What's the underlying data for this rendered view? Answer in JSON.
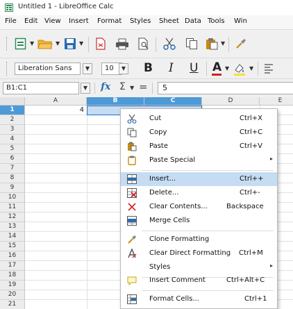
{
  "window": {
    "title": "Untitled 1 - LibreOffice Calc"
  },
  "menubar": {
    "items": [
      "File",
      "Edit",
      "View",
      "Insert",
      "Format",
      "Styles",
      "Sheet",
      "Data",
      "Tools",
      "Win"
    ]
  },
  "toolbar": {
    "font_name": "Liberation Sans",
    "font_size": "10",
    "bold_label": "B",
    "italic_label": "I",
    "underline_label": "U",
    "font_color_label": "A"
  },
  "formula_bar": {
    "name_box": "B1:C1",
    "fx_label": "fx",
    "sum_label": "Σ",
    "equals_label": "=",
    "content": "5"
  },
  "sheet": {
    "columns": [
      "A",
      "B",
      "C",
      "D",
      "E"
    ],
    "rows": [
      "1",
      "2",
      "3",
      "4",
      "5",
      "6",
      "7",
      "8",
      "9",
      "10",
      "11",
      "12",
      "13",
      "14",
      "15",
      "16",
      "17",
      "18",
      "19",
      "20",
      "21"
    ],
    "selected_columns": [
      "B",
      "C"
    ],
    "selected_row": "1",
    "cells": {
      "A1": "4"
    }
  },
  "context_menu": {
    "items": {
      "cut": {
        "label": "Cut",
        "shortcut": "Ctrl+X",
        "icon": "scissors-icon"
      },
      "copy": {
        "label": "Copy",
        "shortcut": "Ctrl+C",
        "icon": "copy-icon"
      },
      "paste": {
        "label": "Paste",
        "shortcut": "Ctrl+V",
        "icon": "paste-icon"
      },
      "paste_special": {
        "label": "Paste Special",
        "icon": "paste-special-icon"
      },
      "insert": {
        "label": "Insert...",
        "shortcut": "Ctrl++",
        "icon": "insert-cells-icon"
      },
      "delete": {
        "label": "Delete...",
        "shortcut": "Ctrl+-",
        "icon": "delete-cells-icon"
      },
      "clear_contents": {
        "label": "Clear Contents...",
        "shortcut": "Backspace",
        "icon": "clear-icon"
      },
      "merge_cells": {
        "label": "Merge Cells",
        "icon": "merge-cells-icon"
      },
      "clone_formatting": {
        "label": "Clone Formatting",
        "icon": "paintbrush-icon"
      },
      "clear_direct_formatting": {
        "label": "Clear Direct Formatting",
        "shortcut": "Ctrl+M",
        "icon": "clear-formatting-icon"
      },
      "styles": {
        "label": "Styles"
      },
      "insert_comment": {
        "label": "Insert Comment",
        "shortcut": "Ctrl+Alt+C",
        "icon": "comment-icon"
      },
      "format_cells": {
        "label": "Format Cells...",
        "shortcut": "Ctrl+1",
        "icon": "format-cells-icon"
      }
    },
    "highlighted": "insert"
  },
  "colors": {
    "selection_header": "#4d9ad9",
    "selection_fill": "#c5dcf3",
    "accent_red": "#d42020",
    "accent_green": "#2e8b57",
    "accent_blue": "#2b6cb0"
  }
}
